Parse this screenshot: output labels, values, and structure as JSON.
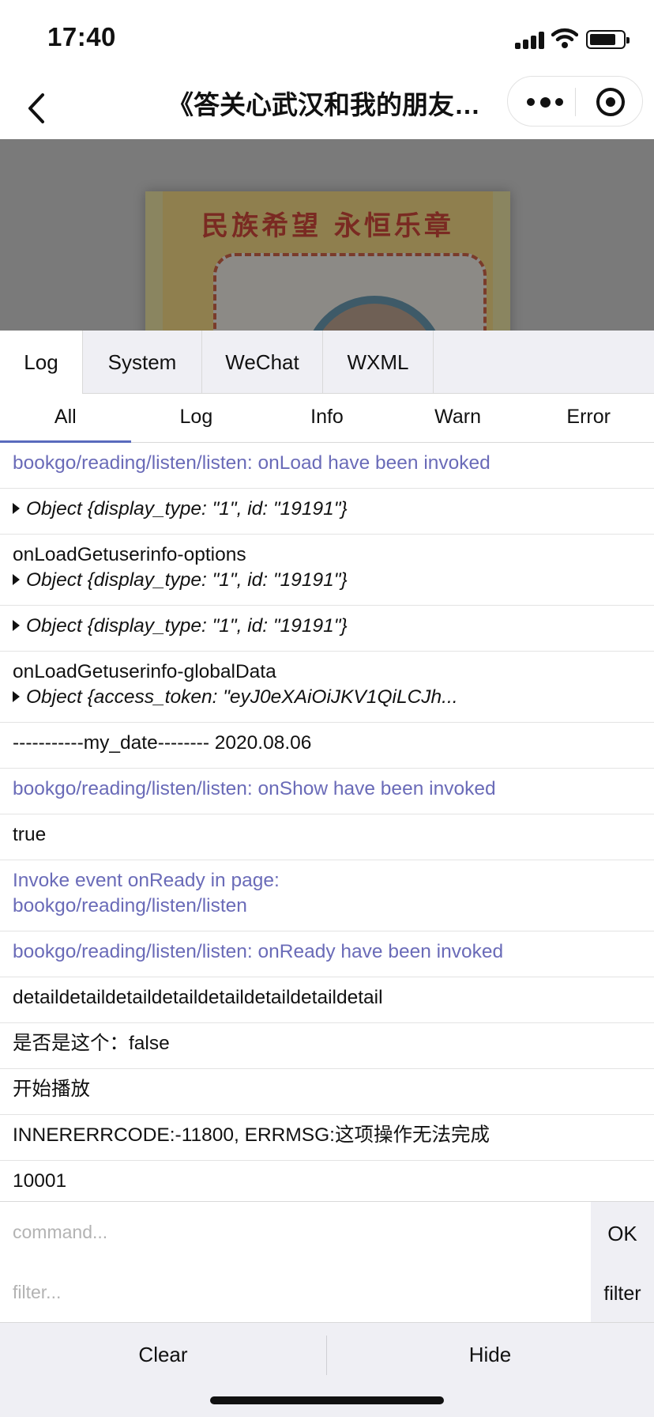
{
  "status_bar": {
    "time": "17:40"
  },
  "nav": {
    "title": "《答关心武汉和我的朋友…"
  },
  "cover": {
    "title": "民族希望 永恒乐章"
  },
  "console": {
    "tabs": [
      {
        "label": "Log",
        "active": true
      },
      {
        "label": "System",
        "active": false
      },
      {
        "label": "WeChat",
        "active": false
      },
      {
        "label": "WXML",
        "active": false
      }
    ],
    "subtabs": [
      {
        "label": "All",
        "active": true
      },
      {
        "label": "Log",
        "active": false
      },
      {
        "label": "Info",
        "active": false
      },
      {
        "label": "Warn",
        "active": false
      },
      {
        "label": "Error",
        "active": false
      }
    ],
    "logs": [
      {
        "line1": "bookgo/reading/listen/listen: onLoad have been invoked"
      },
      {
        "line1": "Object {display_type: \"1\", id: \"19191\"}"
      },
      {
        "line1": "onLoadGetuserinfo-options",
        "line2": "Object {display_type: \"1\", id: \"19191\"}"
      },
      {
        "line1": "Object {display_type: \"1\", id: \"19191\"}"
      },
      {
        "line1": "onLoadGetuserinfo-globalData",
        "line2": "Object {access_token: \"eyJ0eXAiOiJKV1QiLCJh..."
      },
      {
        "line1": "-----------my_date-------- 2020.08.06"
      },
      {
        "line1": "bookgo/reading/listen/listen: onShow have been invoked"
      },
      {
        "line1": "true"
      },
      {
        "line1": "Invoke event onReady in page:",
        "line2": "bookgo/reading/listen/listen"
      },
      {
        "line1": "bookgo/reading/listen/listen: onReady have been invoked"
      },
      {
        "line1": "detaildetaildetaildetaildetaildetaildetaildetail"
      },
      {
        "line1": "是否是这个：false"
      },
      {
        "line1": "开始播放"
      },
      {
        "line1": "INNERERRCODE:-11800, ERRMSG:这项操作无法完成"
      },
      {
        "line1": "10001"
      }
    ],
    "command": {
      "placeholder": "command...",
      "button": "OK"
    },
    "filter": {
      "placeholder": "filter...",
      "button": "filter"
    },
    "bottom": {
      "clear": "Clear",
      "hide": "Hide"
    }
  },
  "colors": {
    "system_log": "#6a6bb8",
    "active_tab_underline": "#5a6bbd"
  },
  "icons": [
    "back-chevron-icon",
    "more-icon",
    "target-icon",
    "signal-icon",
    "wifi-icon",
    "battery-icon",
    "expand-triangle-icon"
  ]
}
